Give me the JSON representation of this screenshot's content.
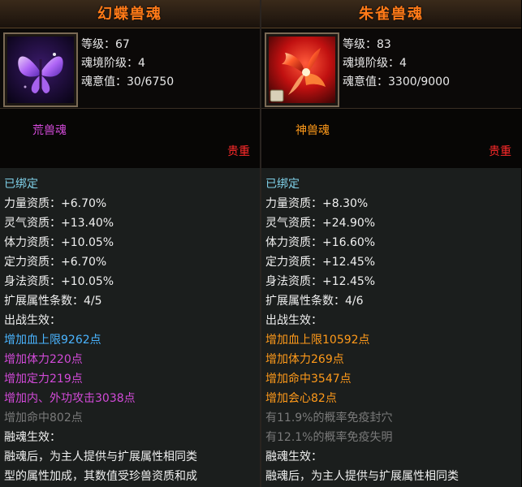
{
  "colors": {
    "title": "#ff7a18",
    "bound": "#7fd0e8",
    "blue": "#4ab4ff",
    "purple": "#d24ad8",
    "gold": "#ff9a1a",
    "grey": "#7a7a7a",
    "rare": "#ff2a2a"
  },
  "left": {
    "title": "幻蝶兽魂",
    "icon": "purple-butterfly-icon",
    "level": "等级：67",
    "realm": "魂境阶级：4",
    "soul": "魂意值：30/6750",
    "type": "荒兽魂",
    "rarity": "贵重",
    "bound": "已绑定",
    "strength": "力量资质：+6.70%",
    "spirit": "灵气资质：+13.40%",
    "vitality": "体力资质：+10.05%",
    "focus": "定力资质：+6.70%",
    "agility": "身法资质：+10.05%",
    "ext": "扩展属性条数：4/5",
    "battle_effect": "出战生效：",
    "effects": [
      "增加血上限9262点",
      "增加体力220点",
      "增加定力219点",
      "增加内、外功攻击3038点",
      "增加命中802点"
    ],
    "fusion_title": "融魂生效：",
    "fusion_lines": [
      "融魂后，为主人提供与扩展属性相同类",
      "型的属性加成，其数值受珍兽资质和成"
    ]
  },
  "right": {
    "title": "朱雀兽魂",
    "icon": "red-phoenix-icon",
    "level": "等级：83",
    "realm": "魂境阶级：4",
    "soul": "魂意值：3300/9000",
    "type": "神兽魂",
    "rarity": "贵重",
    "bound": "已绑定",
    "strength": "力量资质：+8.30%",
    "spirit": "灵气资质：+24.90%",
    "vitality": "体力资质：+16.60%",
    "focus": "定力资质：+12.45%",
    "agility": "身法资质：+12.45%",
    "ext": "扩展属性条数：4/6",
    "battle_effect": "出战生效：",
    "effects": [
      "增加血上限10592点",
      "增加体力269点",
      "增加命中3547点",
      "增加会心82点",
      "有11.9%的概率免疫封穴",
      "有12.1%的概率免疫失明"
    ],
    "fusion_title": "融魂生效：",
    "fusion_lines": [
      "融魂后，为主人提供与扩展属性相同类"
    ]
  }
}
